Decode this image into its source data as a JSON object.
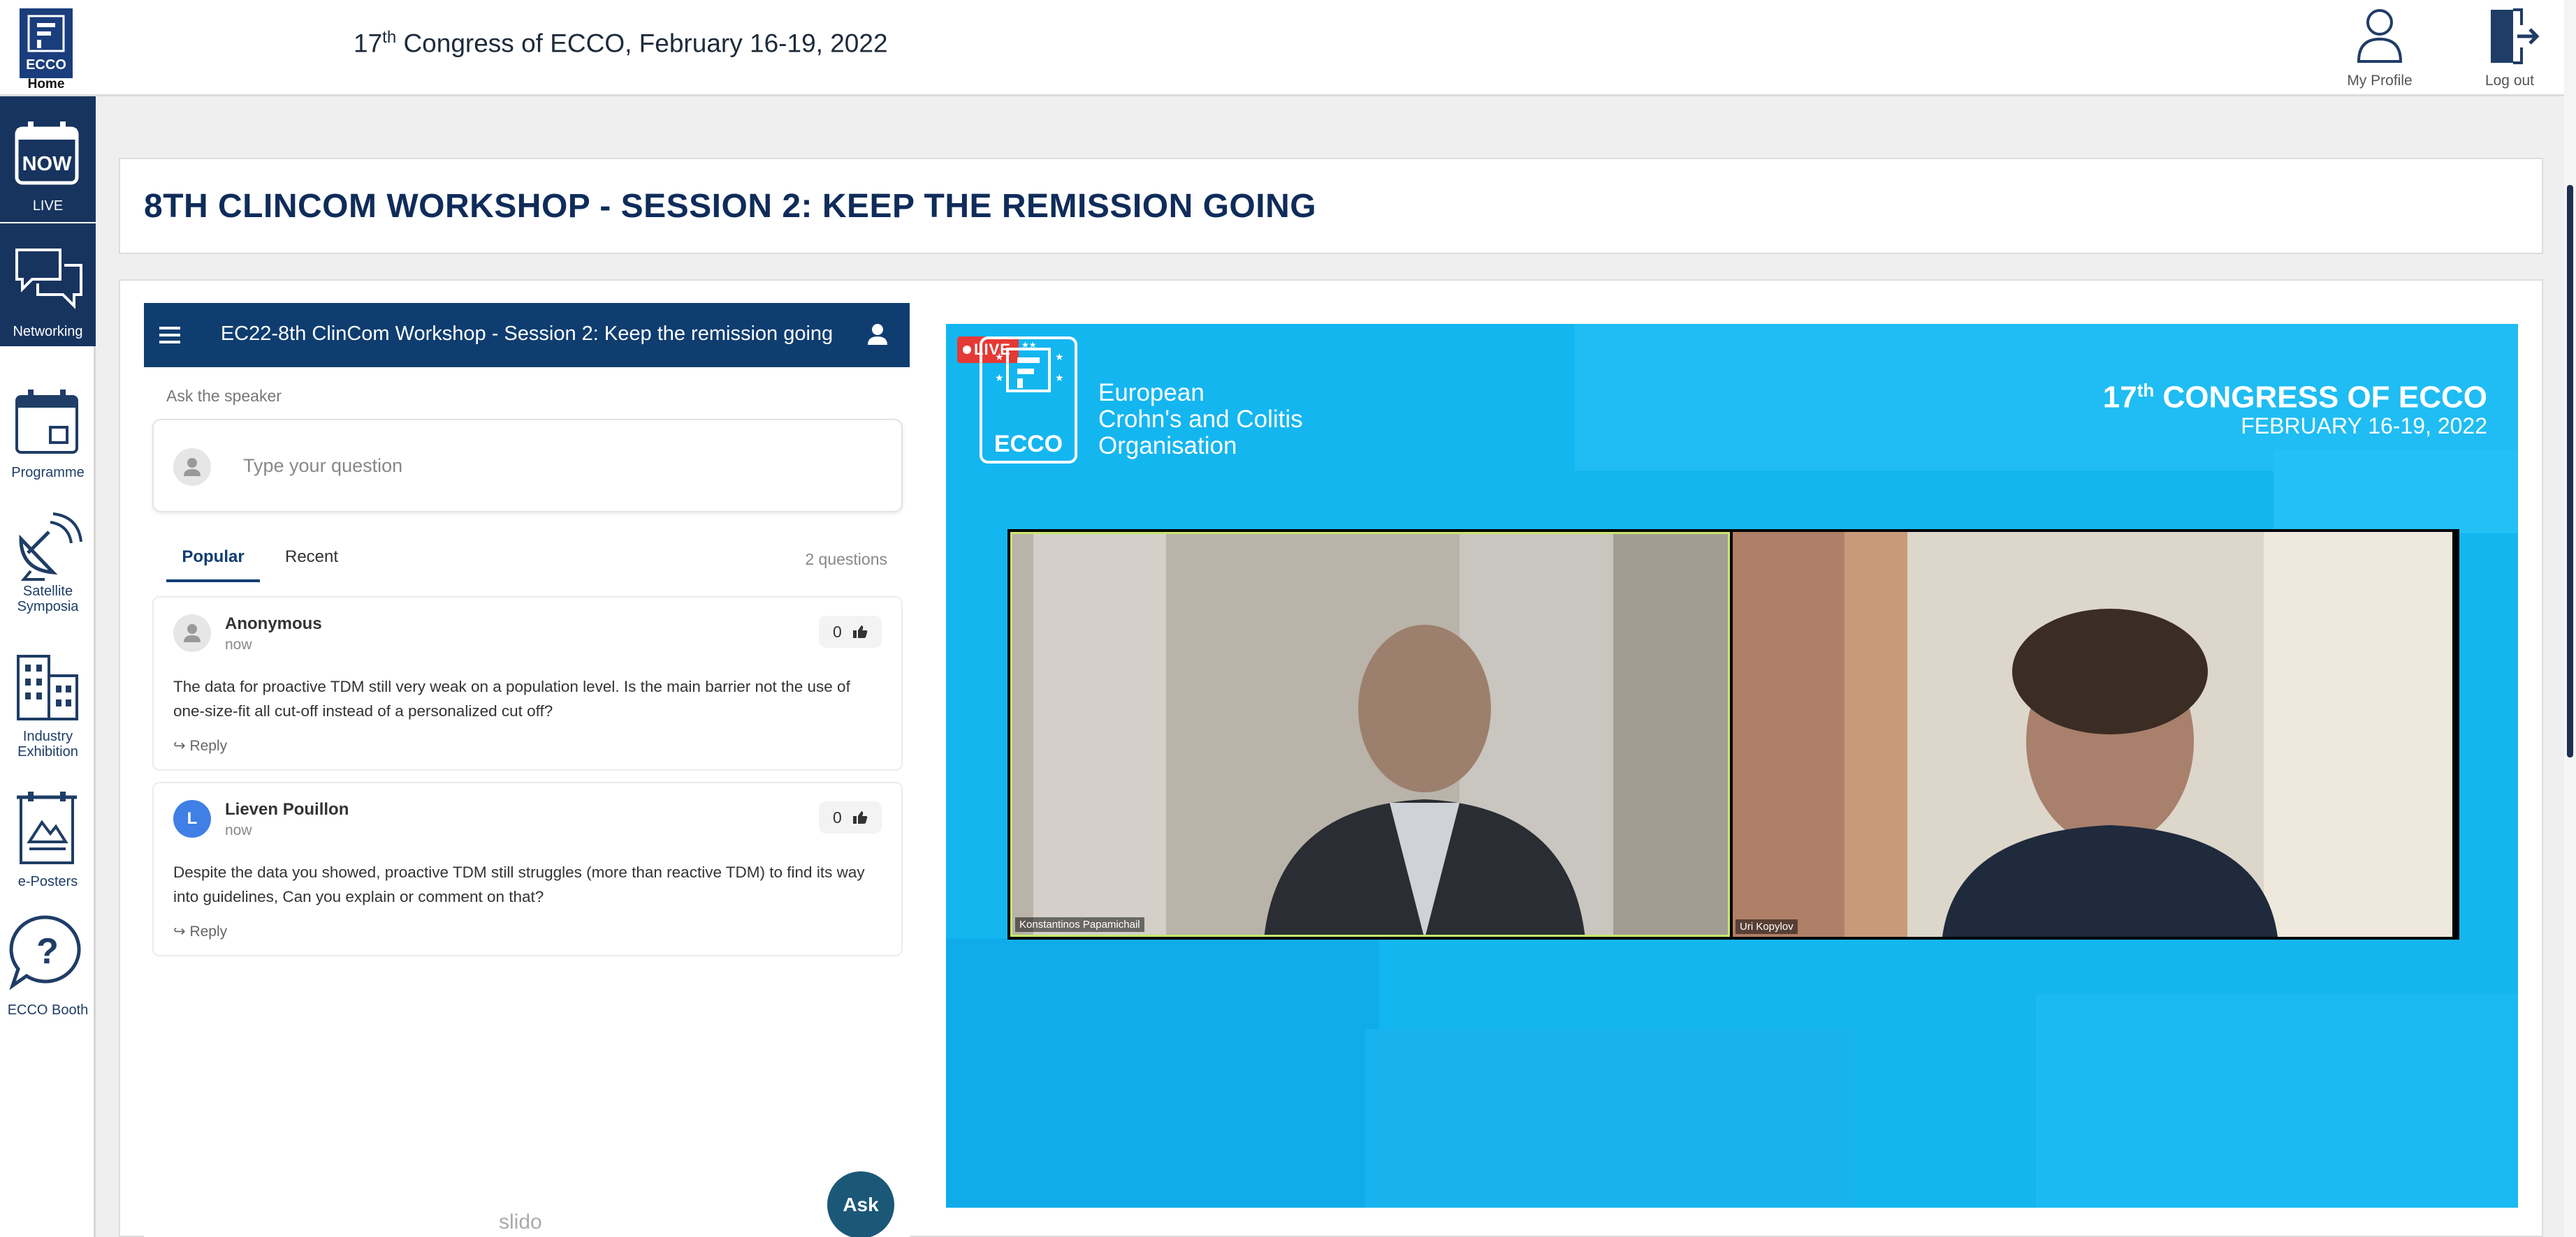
{
  "header": {
    "home_label": "Home",
    "logo_text": "ECCO",
    "congress_prefix": "17",
    "congress_sup": "th",
    "congress_rest": " Congress of ECCO, February 16-19, 2022",
    "profile_label": "My Profile",
    "logout_label": "Log out"
  },
  "sidebar": {
    "items": [
      {
        "label": "LIVE",
        "icon": "now-calendar-icon",
        "icon_text": "NOW"
      },
      {
        "label": "Networking",
        "icon": "chat-bubbles-icon"
      },
      {
        "label": "Programme",
        "icon": "calendar-icon"
      },
      {
        "label": "Satellite Symposia",
        "icon": "satellite-dish-icon"
      },
      {
        "label": "Industry Exhibition",
        "icon": "buildings-icon"
      },
      {
        "label": "e-Posters",
        "icon": "poster-icon"
      },
      {
        "label": "ECCO Booth",
        "icon": "question-bubble-icon"
      }
    ],
    "active_color": "#17345f"
  },
  "session": {
    "title": "8TH CLINCOM WORKSHOP - SESSION 2: KEEP THE REMISSION GOING"
  },
  "slido": {
    "bar_title": "EC22-8th ClinCom Workshop - Session 2: Keep the remission going",
    "ask_label": "Ask the speaker",
    "input_placeholder": "Type your question",
    "tabs": [
      {
        "label": "Popular",
        "active": true
      },
      {
        "label": "Recent",
        "active": false
      }
    ],
    "question_count": "2 questions",
    "questions": [
      {
        "author": "Anonymous",
        "initial": "",
        "time": "now",
        "votes": "0",
        "text": "The data for proactive TDM still very weak on a population level. Is the main barrier not the use of one-size-fit all cut-off instead of a personalized cut off?",
        "reply_label": "Reply"
      },
      {
        "author": "Lieven Pouillon",
        "initial": "L",
        "time": "now",
        "votes": "0",
        "text": "Despite the data you showed, proactive TDM still struggles (more than reactive TDM) to find its way into guidelines, Can you explain or comment on that?",
        "reply_label": "Reply"
      }
    ],
    "brand": "slido",
    "ask_button": "Ask",
    "bar_color": "#0f3d70"
  },
  "video": {
    "live_label": "LIVE",
    "logo_text": "ECCO",
    "org_name": "European\nCrohn's and Colitis\nOrganisation",
    "title_prefix": "17",
    "title_sup": "th",
    "title_rest": " CONGRESS OF ECCO",
    "dates": "FEBRUARY 16-19, 2022",
    "participants": [
      {
        "name": "Konstantinos Papamichail"
      },
      {
        "name": "Uri Kopylov"
      }
    ],
    "bg_color": "#14b6f0"
  }
}
